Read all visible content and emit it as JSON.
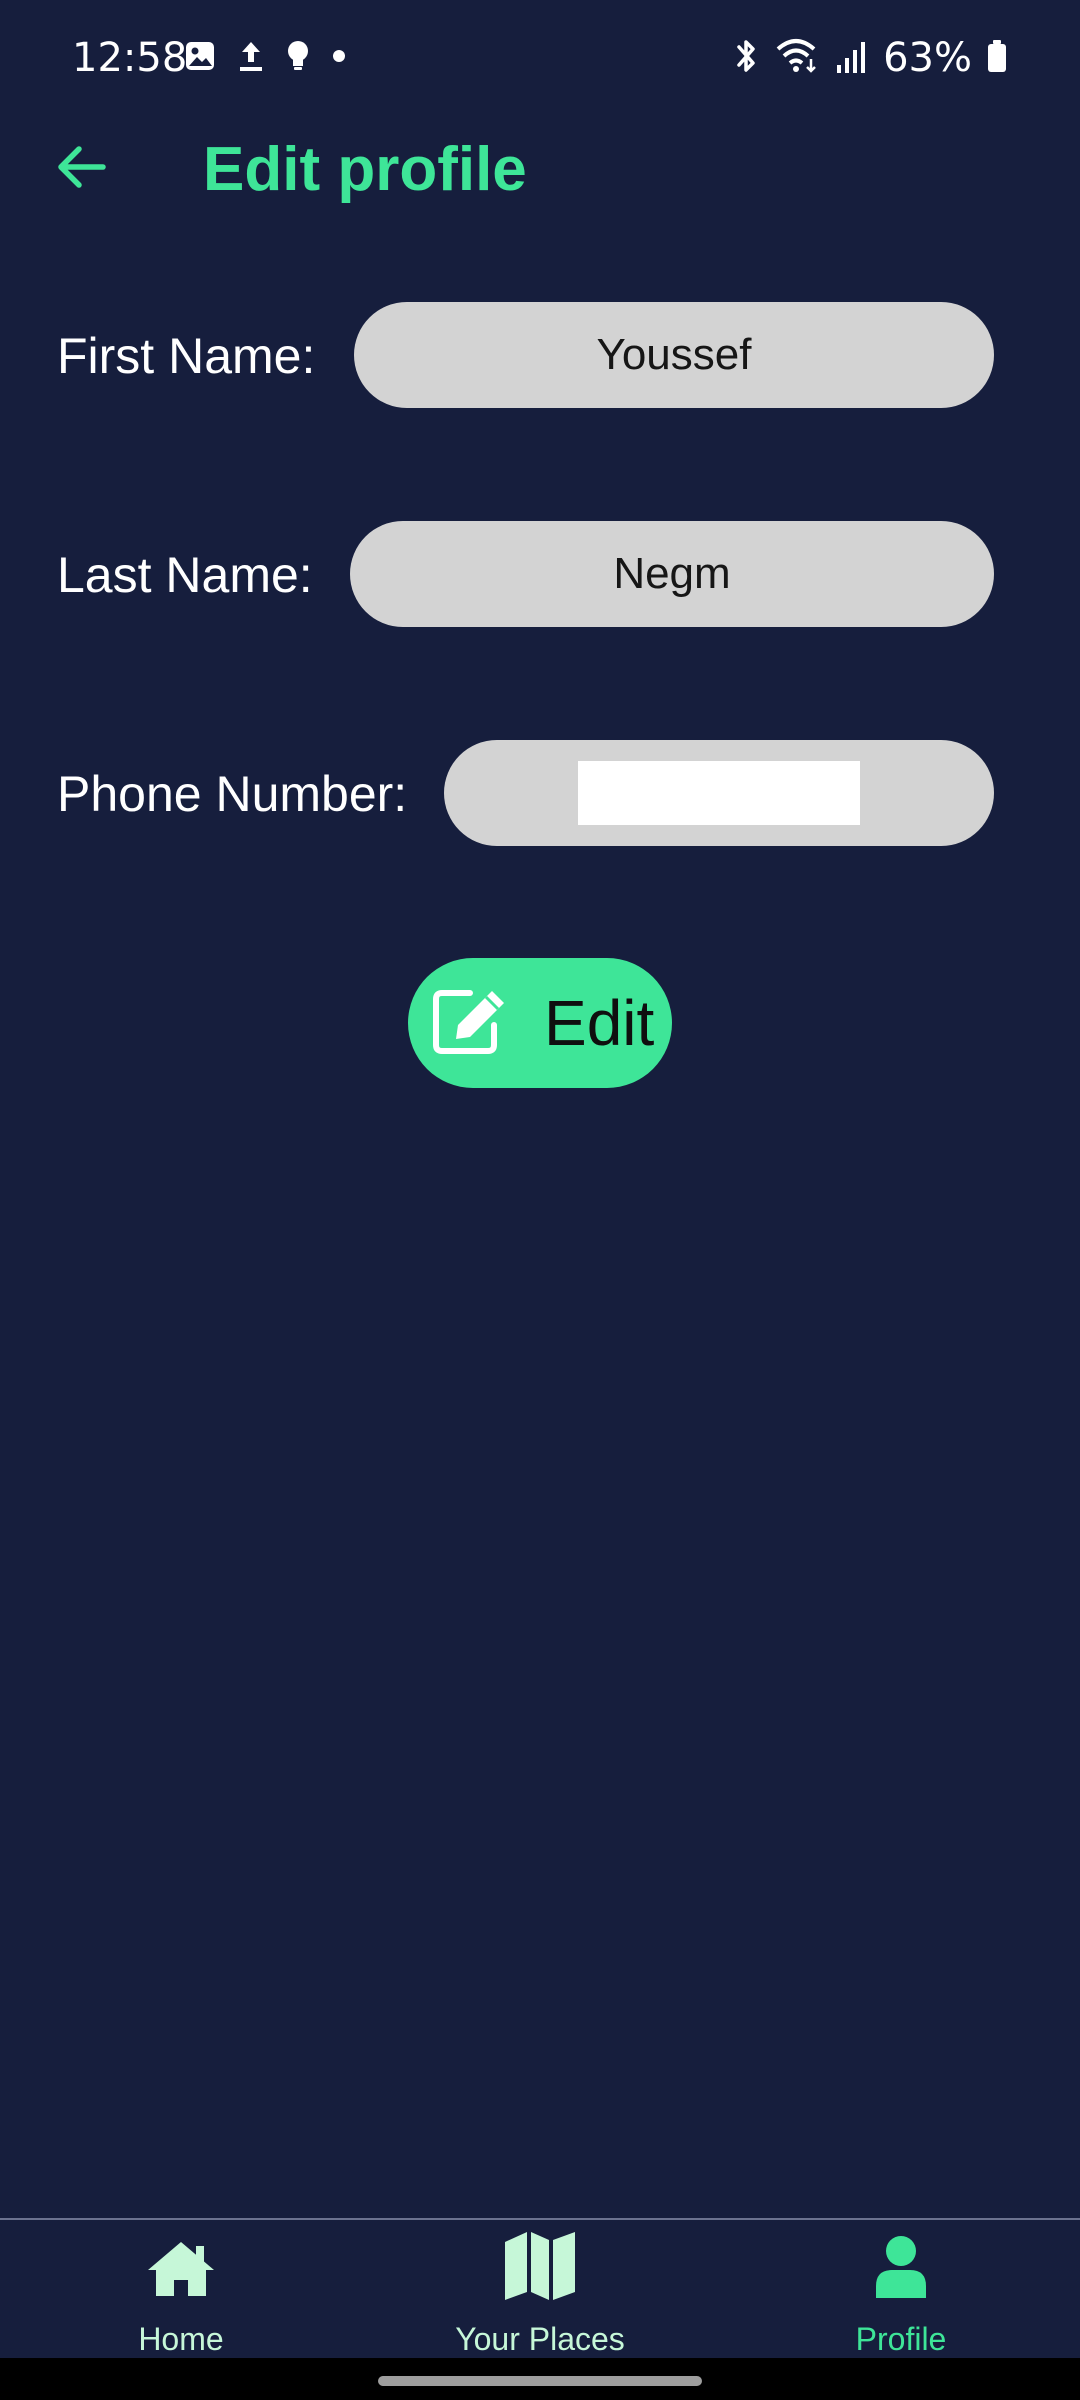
{
  "status_bar": {
    "time": "12:58",
    "battery": "63%",
    "left_icons": [
      "gallery-icon",
      "upload-icon",
      "bulb-icon",
      "dot-icon"
    ],
    "right_icons": [
      "bluetooth-icon",
      "wifi-icon",
      "signal-icon",
      "battery-icon"
    ]
  },
  "app_bar": {
    "title": "Edit profile",
    "back_icon": "arrow-left-icon"
  },
  "form": {
    "first_name": {
      "label": "First Name:",
      "value": "Youssef"
    },
    "last_name": {
      "label": "Last Name:",
      "value": "Negm"
    },
    "phone_number": {
      "label": "Phone Number:",
      "value": ""
    }
  },
  "edit_button": {
    "label": "Edit",
    "icon": "edit-icon"
  },
  "bottom_nav": {
    "items": [
      {
        "label": "Home",
        "icon": "home-icon",
        "active": false
      },
      {
        "label": "Your Places",
        "icon": "map-icon",
        "active": false
      },
      {
        "label": "Profile",
        "icon": "person-icon",
        "active": true
      }
    ]
  },
  "colors": {
    "background": "#161e3d",
    "accent": "#3ee598",
    "nav_inactive": "#c6f7d8",
    "field": "#d3d3d3"
  }
}
